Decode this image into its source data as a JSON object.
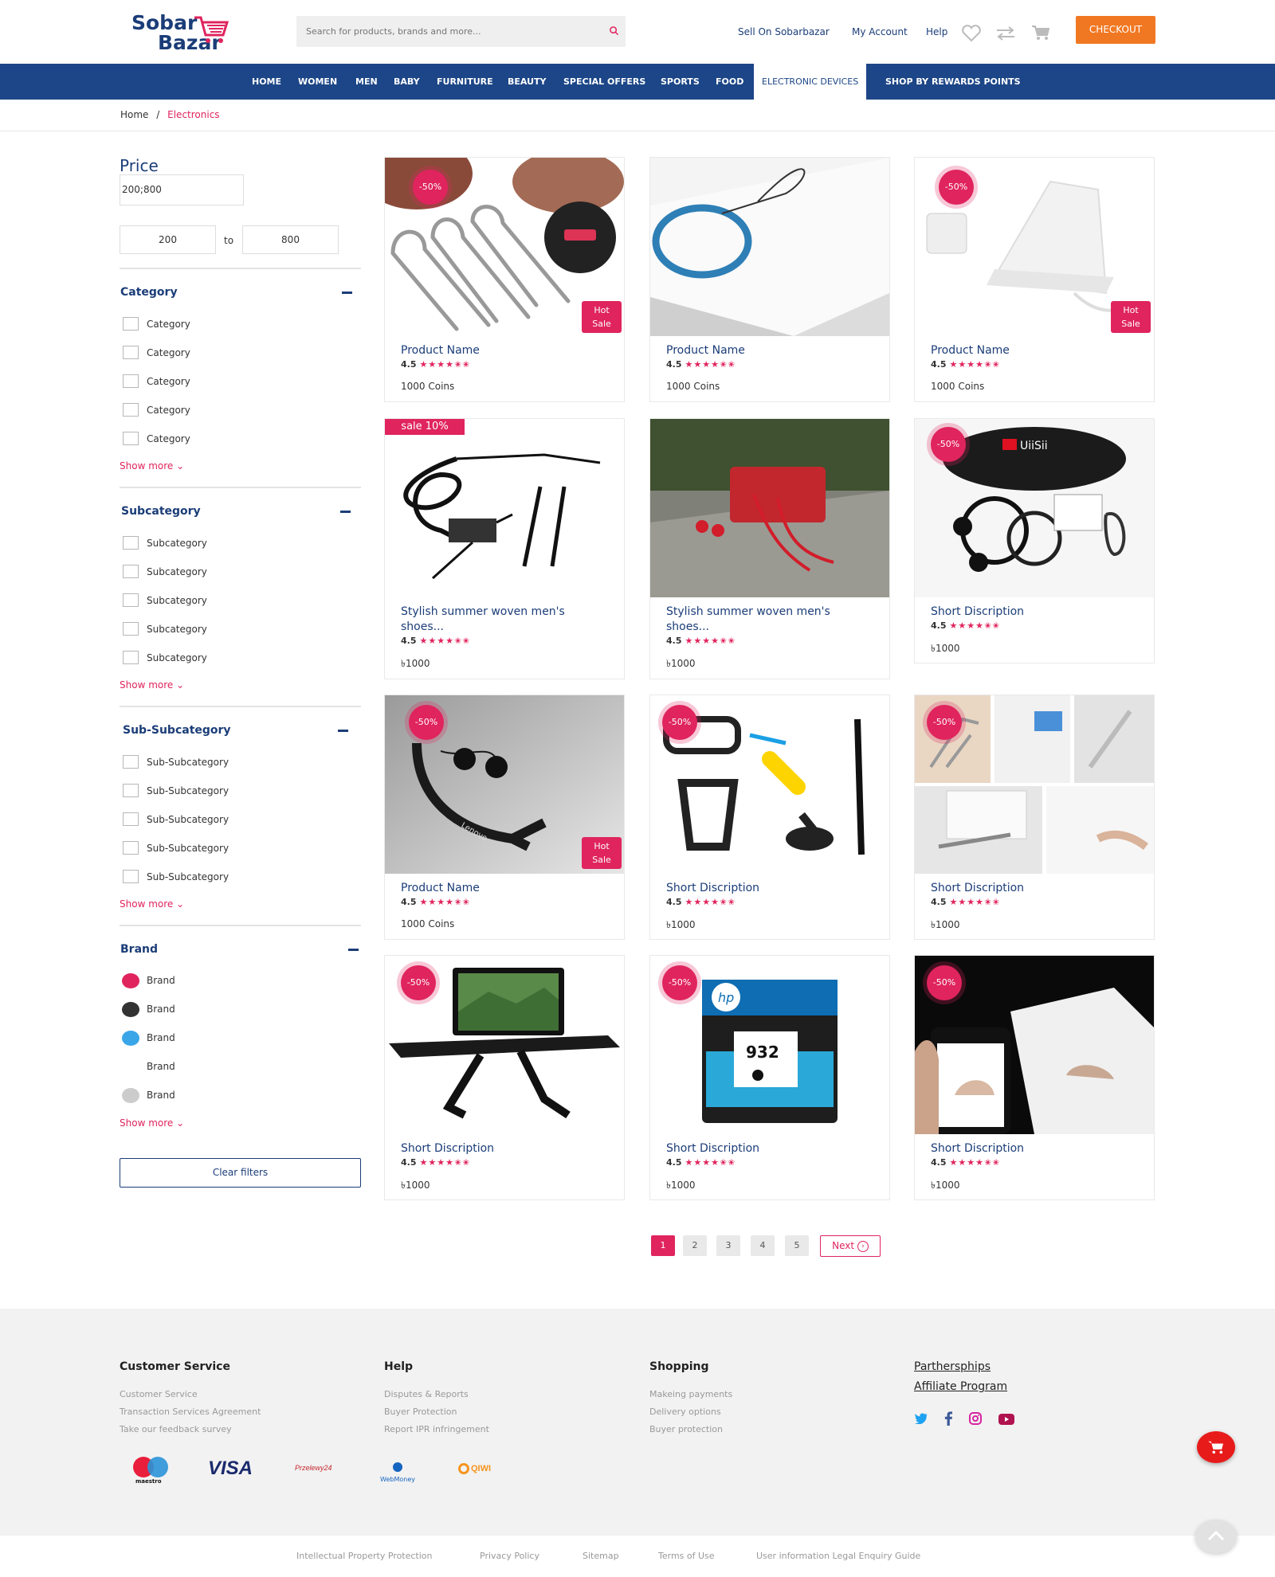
{
  "header": {
    "logo_line1": "Sobar",
    "logo_line2": "Bazar",
    "search_placeholder": "Search for products, brands and more...",
    "links": [
      "Sell On Sobarbazar",
      "My Account",
      "Help"
    ],
    "checkout": "CHECKOUT"
  },
  "nav": [
    "HOME",
    "WOMEN",
    "MEN",
    "BABY",
    "FURNITURE",
    "BEAUTY",
    "SPECIAL OFFERS",
    "SPORTS",
    "FOOD",
    "ELECTRONIC DEVICES",
    "SHOP BY REWARDS POINTS"
  ],
  "breadcrumb": {
    "home": "Home",
    "sep": "/",
    "current": "Electronics"
  },
  "sidebar": {
    "price_title": "Price",
    "price_value": "200;800",
    "min": "200",
    "to": "to",
    "max": "800",
    "category": {
      "title": "Category",
      "items": [
        "Category",
        "Category",
        "Category",
        "Category",
        "Category"
      ]
    },
    "subcategory": {
      "title": "Subcategory",
      "items": [
        "Subcategory",
        "Subcategory",
        "Subcategory",
        "Subcategory",
        "Subcategory"
      ]
    },
    "subsubcategory": {
      "title": "Sub-Subcategory",
      "items": [
        "Sub-Subcategory",
        "Sub-Subcategory",
        "Sub-Subcategory",
        "Sub-Subcategory",
        "Sub-Subcategory"
      ]
    },
    "brand": {
      "title": "Brand",
      "items": [
        {
          "label": "Brand",
          "color": "#e0245e"
        },
        {
          "label": "Brand",
          "color": "#333333"
        },
        {
          "label": "Brand",
          "color": "#3aa6e8"
        },
        {
          "label": "Brand",
          "color": "#ffffff"
        },
        {
          "label": "Brand",
          "color": "#cccccc"
        }
      ]
    },
    "show_more": "Show more",
    "clear": "Clear filters"
  },
  "products": [
    {
      "name": "Product Name",
      "rating": "4.5",
      "price": "1000 Coins",
      "badge": "-50%",
      "hot1": "Hot",
      "hot2": "Sale"
    },
    {
      "name": "Product Name",
      "rating": "4.5",
      "price": "1000 Coins"
    },
    {
      "name": "Product Name",
      "rating": "4.5",
      "price": "1000 Coins",
      "badge": "-50%",
      "hot1": "Hot",
      "hot2": "Sale"
    },
    {
      "name": "Stylish summer woven men's shoes...",
      "rating": "4.5",
      "price": "৳1000",
      "ribbon": "sale 10%"
    },
    {
      "name": "Stylish summer woven men's shoes...",
      "rating": "4.5",
      "price": "৳1000"
    },
    {
      "name": "Short Discription",
      "rating": "4.5",
      "price": "৳1000",
      "badge": "-50%"
    },
    {
      "name": "Product Name",
      "rating": "4.5",
      "price": "1000 Coins",
      "badge": "-50%",
      "hot1": "Hot",
      "hot2": "Sale"
    },
    {
      "name": "Short Discription",
      "rating": "4.5",
      "price": "৳1000",
      "badge": "-50%"
    },
    {
      "name": "Short Discription",
      "rating": "4.5",
      "price": "৳1000",
      "badge": "-50%"
    },
    {
      "name": "Short Discription",
      "rating": "4.5",
      "price": "৳1000",
      "badge": "-50%"
    },
    {
      "name": "Short Discription",
      "rating": "4.5",
      "price": "৳1000",
      "badge": "-50%"
    },
    {
      "name": "Short Discription",
      "rating": "4.5",
      "price": "৳1000",
      "badge": "-50%"
    }
  ],
  "image_text": {
    "uiisii": "UiiSii",
    "hp_num": "932",
    "hp_logo": "hp",
    "lenovo": "Lenovo"
  },
  "stars": "★★★★✬✬",
  "pagination": {
    "pages": [
      "1",
      "2",
      "3",
      "4",
      "5"
    ],
    "next": "Next"
  },
  "footer": {
    "cols": [
      {
        "title": "Customer Service",
        "links": [
          "Customer Service",
          "Transaction Services Agreement",
          "Take our feedback survey"
        ]
      },
      {
        "title": "Help",
        "links": [
          "Disputes & Reports",
          "Buyer Protection",
          "Report IPR infringement"
        ]
      },
      {
        "title": "Shopping",
        "links": [
          "Makeing payments",
          "Delivery options",
          "Buyer protection"
        ]
      }
    ],
    "partner_links": [
      "Parthersphips",
      "Affiliate Program"
    ],
    "payments": [
      "maestro",
      "VISA",
      "Przelewy24",
      "WebMoney",
      "QIWI"
    ],
    "bottom_links": [
      "Intellectual Property Protection",
      "Privacy Policy",
      "Sitemap",
      "Terms of Use",
      "User information Legal Enquiry Guide"
    ]
  },
  "colors": {
    "brand_blue": "#1c4687",
    "accent": "#e0245e",
    "checkout": "#f17822"
  }
}
